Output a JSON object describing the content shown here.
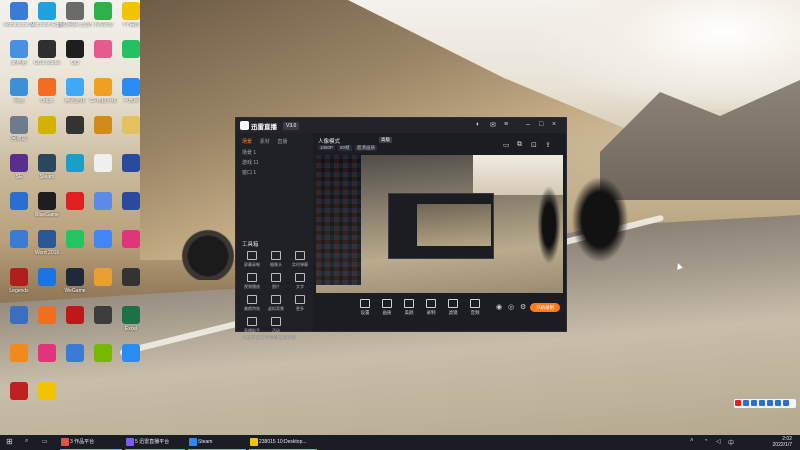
{
  "desktop": {
    "icons": [
      {
        "label": "Administrat or",
        "color": "#3a7bd5"
      },
      {
        "label": "Microsoft Edge",
        "color": "#1fa2e0"
      },
      {
        "label": "活动网易 云音乐",
        "color": "#6b6b6b"
      },
      {
        "label": "小鸭贝安",
        "color": "#2bb34a"
      },
      {
        "label": "YY语音",
        "color": "#f2c400"
      },
      {
        "label": "此电脑",
        "color": "#4a90e2"
      },
      {
        "label": "OBS Studio",
        "color": "#2f2f2f"
      },
      {
        "label": "QQ",
        "color": "#1e1e1e"
      },
      {
        "label": "",
        "color": "#e65a8c"
      },
      {
        "label": "",
        "color": "#25c061"
      },
      {
        "label": "网络",
        "color": "#3d8fd8"
      },
      {
        "label": "Origin",
        "color": "#f56c1e"
      },
      {
        "label": "腾讯游戏",
        "color": "#3fa9f5"
      },
      {
        "label": "CF穿越火线",
        "color": "#f0a020"
      },
      {
        "label": "卢教师",
        "color": "#2a8cf0"
      },
      {
        "label": "回收站",
        "color": "#6d7b8c"
      },
      {
        "label": "",
        "color": "#d4b200"
      },
      {
        "label": "",
        "color": "#333333"
      },
      {
        "label": "",
        "color": "#d28b1a"
      },
      {
        "label": "",
        "color": "#e3c060"
      },
      {
        "label": "SE",
        "color": "#5a2e8c"
      },
      {
        "label": "Steam",
        "color": "#2a475e"
      },
      {
        "label": "",
        "color": "#18a0c8"
      },
      {
        "label": "",
        "color": "#f0f0f0"
      },
      {
        "label": "",
        "color": "#2a4aa0"
      },
      {
        "label": "",
        "color": "#2a6fd0"
      },
      {
        "label": "BlueGame",
        "color": "#1e1e1e"
      },
      {
        "label": "",
        "color": "#e02020"
      },
      {
        "label": "",
        "color": "#5c8ae6"
      },
      {
        "label": "",
        "color": "#2a4aa0"
      },
      {
        "label": "",
        "color": "#3a7bd5"
      },
      {
        "label": "Word 2016",
        "color": "#2b5797"
      },
      {
        "label": "",
        "color": "#22c55e"
      },
      {
        "label": "",
        "color": "#4285f4"
      },
      {
        "label": "",
        "color": "#e0357a"
      },
      {
        "label": "Legends",
        "color": "#b01e1e"
      },
      {
        "label": "",
        "color": "#1b74e4"
      },
      {
        "label": "WeGame",
        "color": "#1e2a3a"
      },
      {
        "label": "",
        "color": "#e8a030"
      },
      {
        "label": "",
        "color": "#333333"
      },
      {
        "label": "",
        "color": "#3a6fc0"
      },
      {
        "label": "",
        "color": "#f07020"
      },
      {
        "label": "",
        "color": "#c01818"
      },
      {
        "label": "",
        "color": "#3c3c3c"
      },
      {
        "label": "Excel",
        "color": "#1e7145"
      },
      {
        "label": "",
        "color": "#f08a1a"
      },
      {
        "label": "",
        "color": "#e0357a"
      },
      {
        "label": "",
        "color": "#3a7bd5"
      },
      {
        "label": "",
        "color": "#76b900"
      },
      {
        "label": "",
        "color": "#2a8cf0"
      },
      {
        "label": "",
        "color": "#c02020"
      },
      {
        "label": "",
        "color": "#f2c400"
      }
    ]
  },
  "app": {
    "name": "迅雷直播",
    "version_badge": "V3.0",
    "sidebar_tabs": [
      {
        "label": "场景",
        "active": true
      },
      {
        "label": "素材",
        "active": false
      },
      {
        "label": "直播",
        "active": false
      }
    ],
    "projects": [
      "场景 1",
      "游戏 11",
      "窗口 1"
    ],
    "tools_header": "工具箱",
    "tools": [
      {
        "label": "屏幕录制"
      },
      {
        "label": "摄像头"
      },
      {
        "label": "实时弹幕"
      },
      {
        "label": "视频播放"
      },
      {
        "label": "图片"
      },
      {
        "label": "文字"
      },
      {
        "label": "美颜特效"
      },
      {
        "label": "虚拟背景"
      },
      {
        "label": "更多"
      },
      {
        "label": "直播助手"
      },
      {
        "label": "活动"
      }
    ],
    "footer": "点击开启实时弹幕互动功能",
    "main_title": "人像模式",
    "main_tag": "高级",
    "chips": [
      "1080P",
      "60帧",
      "超清画质"
    ],
    "bottom_buttons": [
      "设置",
      "画质",
      "美颜",
      "录制",
      "滤镜",
      "音频"
    ],
    "record_label": "开始录制"
  },
  "taskbar": {
    "items": [
      {
        "label": "3 作品平台",
        "color": "#e05050"
      },
      {
        "label": "5 迅雷直播平台",
        "color": "#7a5cf0"
      },
      {
        "label": "Steam",
        "color": "#2a8cf0"
      },
      {
        "label": "238015 10:Desktop...",
        "color": "#f2c400"
      }
    ],
    "time": "2:02",
    "date": "2022/1/7"
  }
}
